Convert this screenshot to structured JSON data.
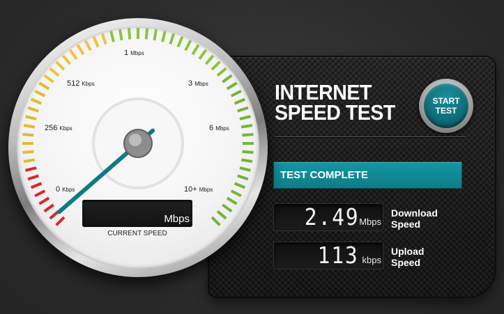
{
  "app": {
    "title_line1": "INTERNET",
    "title_line2": "SPEED TEST",
    "start_button": {
      "line1": "START",
      "line2": "TEST"
    }
  },
  "gauge": {
    "current_speed_unit": "Mbps",
    "current_speed_caption": "CURRENT SPEED",
    "scale": [
      {
        "num": "0",
        "unit": "Kbps"
      },
      {
        "num": "256",
        "unit": "Kbps"
      },
      {
        "num": "512",
        "unit": "Kbps"
      },
      {
        "num": "1",
        "unit": "Mbps"
      },
      {
        "num": "3",
        "unit": "Mbps"
      },
      {
        "num": "6",
        "unit": "Mbps"
      },
      {
        "num": "10+",
        "unit": "Mbps"
      }
    ],
    "needle_value_fraction": 0.0,
    "accent_color": "#0e7a86",
    "zone_colors": [
      "#d9262d",
      "#e2bb2c",
      "#f0c33a",
      "#8cc43f",
      "#74b53a"
    ]
  },
  "status": {
    "text": "TEST COMPLETE"
  },
  "results": {
    "download": {
      "value": "2.49",
      "unit": "Mbps",
      "label_line1": "Download",
      "label_line2": "Speed"
    },
    "upload": {
      "value": "113",
      "unit": "kbps",
      "label_line1": "Upload",
      "label_line2": "Speed"
    }
  }
}
